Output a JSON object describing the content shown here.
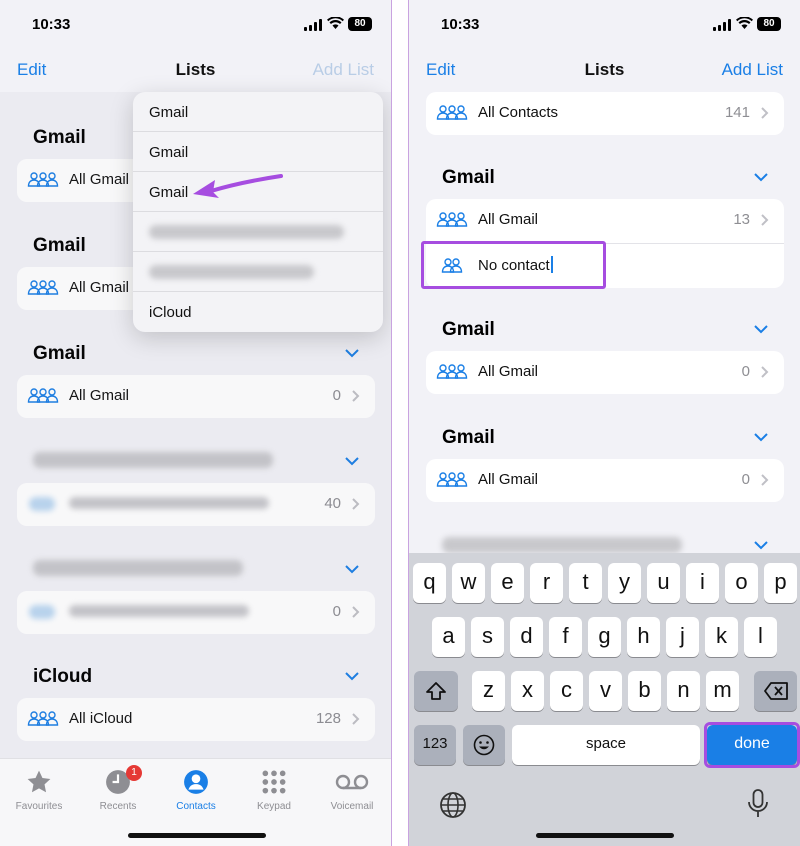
{
  "status": {
    "time": "10:33",
    "battery": "80"
  },
  "left": {
    "nav": {
      "edit": "Edit",
      "title": "Lists",
      "add": "Add List"
    },
    "sections": [
      {
        "header": "Gmail",
        "row": "All Gmail"
      },
      {
        "header": "Gmail",
        "row": "All Gmail"
      },
      {
        "header": "Gmail",
        "row": "All Gmail",
        "count": "0"
      },
      {
        "count": "40"
      },
      {
        "count": "0"
      },
      {
        "header": "iCloud",
        "row": "All iCloud",
        "count": "128"
      }
    ],
    "menu": [
      "Gmail",
      "Gmail",
      "Gmail",
      "iCloud"
    ]
  },
  "tabs": [
    {
      "label": "Favourites",
      "icon": "star-icon"
    },
    {
      "label": "Recents",
      "icon": "clock-icon",
      "badge": "1"
    },
    {
      "label": "Contacts",
      "icon": "person-icon",
      "active": true
    },
    {
      "label": "Keypad",
      "icon": "keypad-icon"
    },
    {
      "label": "Voicemail",
      "icon": "voicemail-icon"
    }
  ],
  "right": {
    "nav": {
      "edit": "Edit",
      "title": "Lists",
      "add": "Add List"
    },
    "all_contacts": {
      "label": "All Contacts",
      "count": "141"
    },
    "sections": [
      {
        "header": "Gmail",
        "row": "All Gmail",
        "count": "13",
        "new_group": "No contact"
      },
      {
        "header": "Gmail",
        "row": "All Gmail",
        "count": "0"
      },
      {
        "header": "Gmail",
        "row": "All Gmail",
        "count": "0"
      }
    ]
  },
  "keyboard": {
    "row1": [
      "q",
      "w",
      "e",
      "r",
      "t",
      "y",
      "u",
      "i",
      "o",
      "p"
    ],
    "row2": [
      "a",
      "s",
      "d",
      "f",
      "g",
      "h",
      "j",
      "k",
      "l"
    ],
    "row3": [
      "z",
      "x",
      "c",
      "v",
      "b",
      "n",
      "m"
    ],
    "numbers": "123",
    "space": "space",
    "done": "done"
  },
  "colors": {
    "accent": "#1a7fe6",
    "highlight": "#a64de0",
    "badge": "#e53935"
  }
}
